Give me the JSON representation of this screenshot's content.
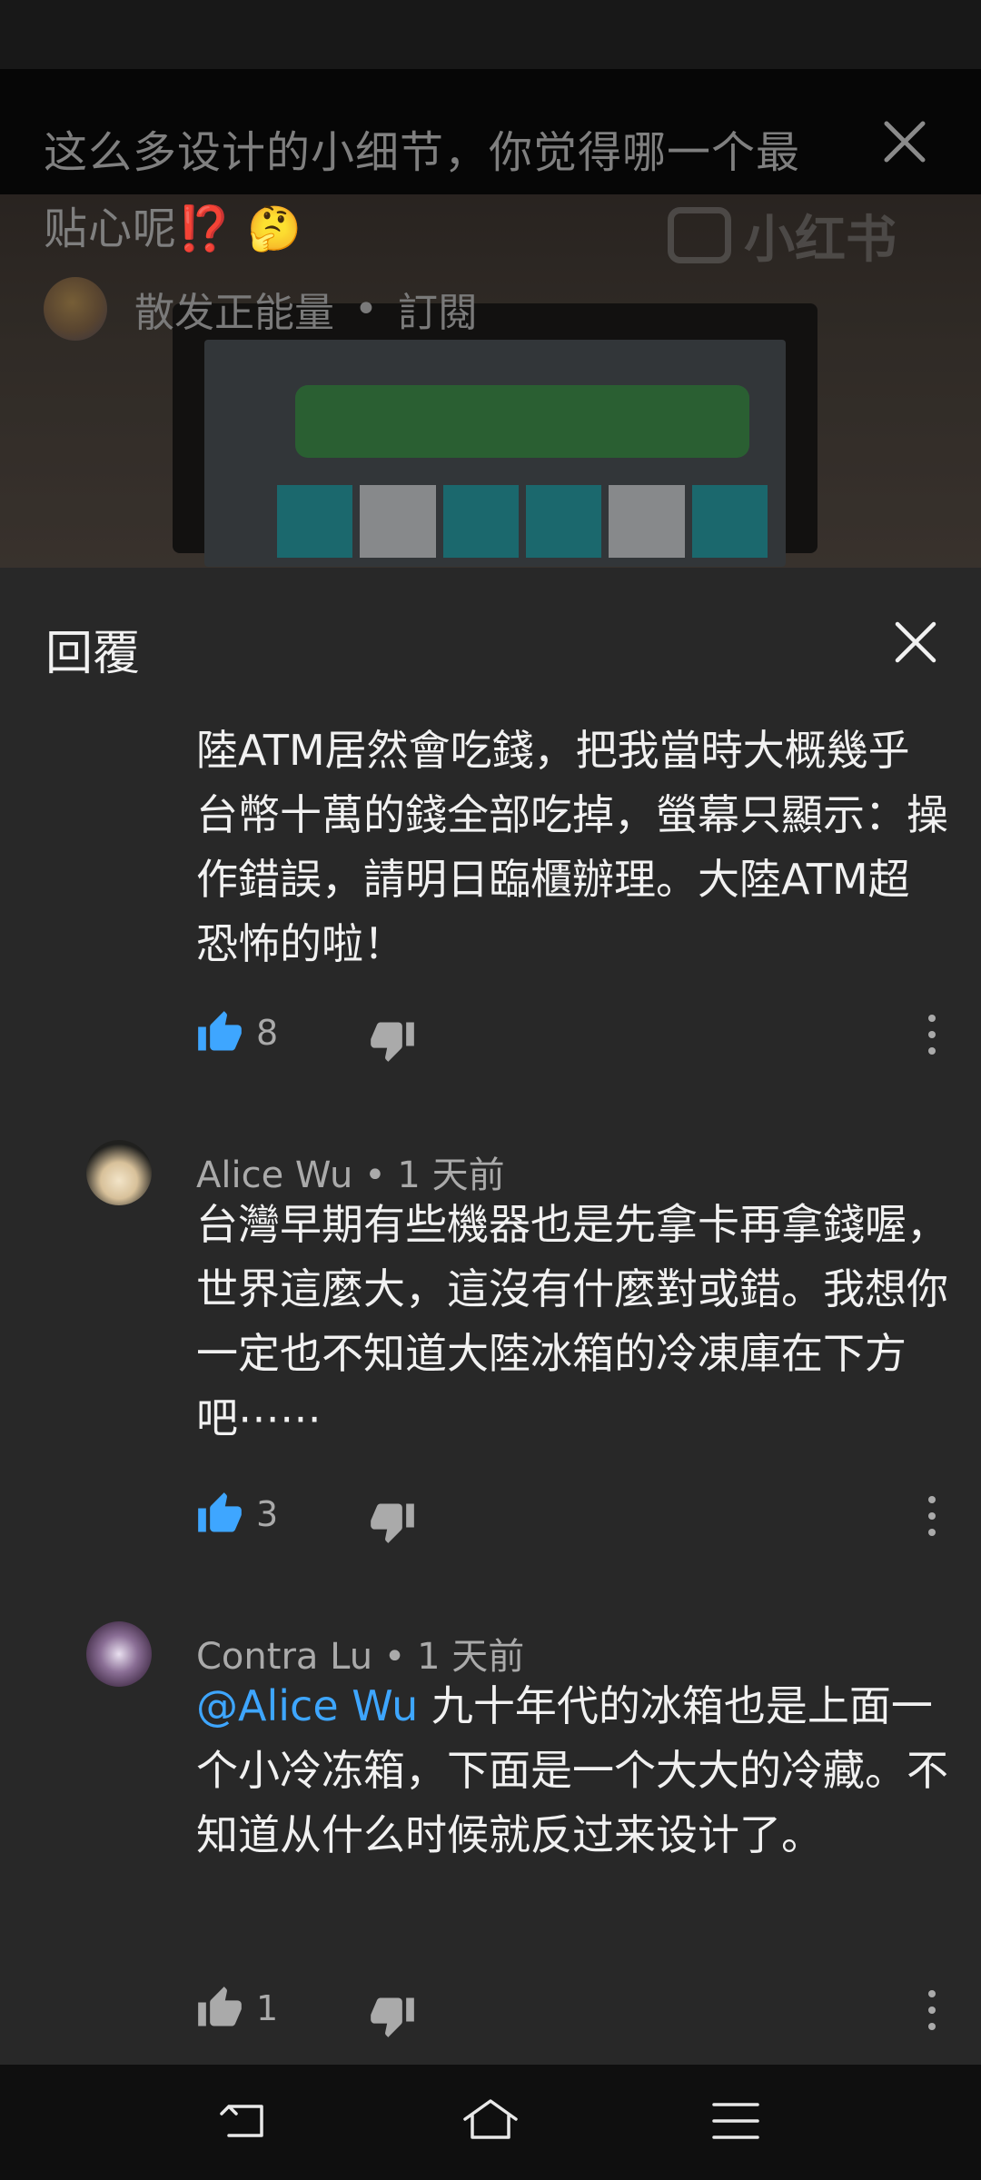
{
  "video": {
    "title_text": "这么多设计的小细节，你觉得哪一个最贴心呢",
    "title_emoji_marks": "⁉️",
    "title_emoji_face": "🤔",
    "channel": "散发正能量",
    "separator": "•",
    "subscribe": "訂閱",
    "watermark": "小红书"
  },
  "panel": {
    "title": "回覆"
  },
  "comments": [
    {
      "text": "陸ATM居然會吃錢，把我當時大概幾乎台幣十萬的錢全部吃掉，螢幕只顯示：操作錯誤，請明日臨櫃辦理。大陸ATM超恐怖的啦！",
      "likes": "8"
    },
    {
      "author": "Alice Wu",
      "time": "• 1 天前",
      "text": "台灣早期有些機器也是先拿卡再拿錢喔，世界這麼大，這沒有什麼對或錯。我想你一定也不知道大陸冰箱的冷凍庫在下方吧⋯⋯",
      "likes": "3"
    },
    {
      "author": "Contra Lu",
      "time": "• 1 天前",
      "mention": "@Alice Wu",
      "text": "九十年代的冰箱也是上面一个小冷冻箱，下面是一个大大的冷藏。不知道从什么时候就反过来设计了。",
      "likes": "1"
    }
  ],
  "colors": {
    "background": "#282828",
    "text": "#f1f1f1",
    "secondary_text": "#aaaaaa",
    "accent": "#3ea6ff"
  },
  "icons": [
    "close-icon",
    "thumbs-up-icon",
    "thumbs-down-icon",
    "more-vert-icon",
    "back-icon",
    "home-icon",
    "menu-icon"
  ]
}
